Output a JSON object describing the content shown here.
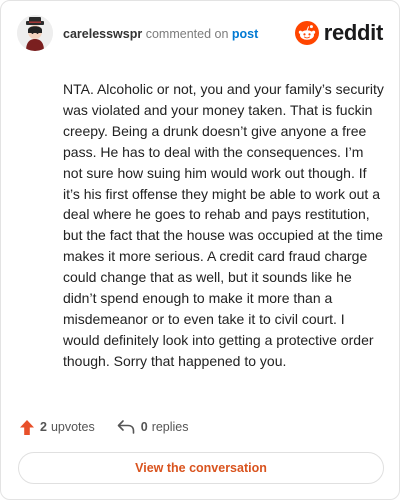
{
  "header": {
    "username": "carelesswspr",
    "action_text": "commented on",
    "post_link": "post",
    "brand_name": "reddit"
  },
  "comment": {
    "text": "NTA. Alcoholic or not, you and your family’s security was violated and your money taken. That is fuckin creepy. Being a drunk doesn’t give anyone a free pass. He has to deal with the consequences. I’m not sure how suing him would work out though. If it’s his first offense they might be able to work out a deal where he goes to rehab and pays restitution, but the fact that the house was occupied at the time makes it more serious. A credit card fraud charge could change that as well, but it sounds like he didn’t spend enough to make it more than a misdemeanor or to even take it to civil court. I would definitely look into getting a protective order though. Sorry that happened to you."
  },
  "stats": {
    "upvotes_count": "2",
    "upvotes_label": "upvotes",
    "replies_count": "0",
    "replies_label": "replies"
  },
  "cta": {
    "label": "View the conversation"
  },
  "colors": {
    "brand_orange": "#ff4500",
    "link_blue": "#0079d3",
    "cta_text": "#d9531e",
    "upvote_icon": "#e8502a"
  },
  "icons": {
    "avatar": "user-avatar",
    "brand": "reddit-logo-icon",
    "upvote": "upvote-arrow-icon",
    "reply": "reply-arrow-icon"
  }
}
